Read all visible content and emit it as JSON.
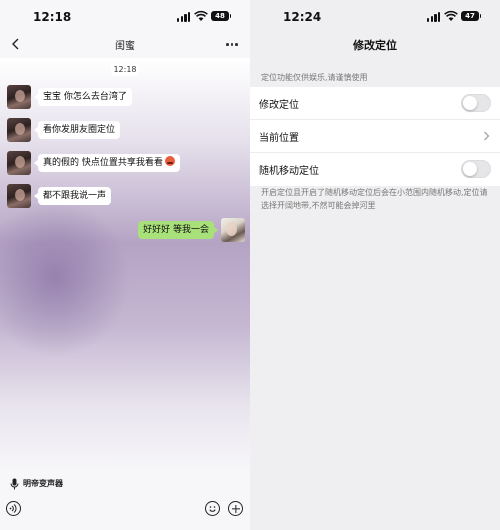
{
  "left": {
    "status": {
      "time": "12:18",
      "battery": "48"
    },
    "chat": {
      "title": "闺蜜",
      "time_label": "12:18"
    },
    "messages": [
      {
        "side": "in",
        "text": "宝宝 你怎么去台湾了"
      },
      {
        "side": "in",
        "text": "看你发朋友圈定位"
      },
      {
        "side": "in",
        "text": "真的假的 快点位置共享我看看",
        "emoji": "angry-face-icon"
      },
      {
        "side": "in",
        "text": "都不跟我说一声"
      },
      {
        "side": "out",
        "text": "好好好 等我一会"
      }
    ],
    "voice_changer_label": "明帝变声器",
    "input_placeholder": ""
  },
  "right": {
    "status": {
      "time": "12:24",
      "battery": "47"
    },
    "title": "修改定位",
    "hint_top": "定位功能仅供娱乐,请谨慎使用",
    "rows": [
      {
        "label": "修改定位",
        "control": "toggle",
        "on": false
      },
      {
        "label": "当前位置",
        "control": "chevron"
      },
      {
        "label": "随机移动定位",
        "control": "toggle",
        "on": false
      }
    ],
    "hint_bottom": "开启定位且开启了随机移动定位后会在小范围内随机移动,定位请选择开阔地带,不然可能会掉河里"
  },
  "colors": {
    "out_bubble": "#a8e07a",
    "in_bubble": "#ffffff",
    "toggle_off": "#e6e6e9"
  }
}
